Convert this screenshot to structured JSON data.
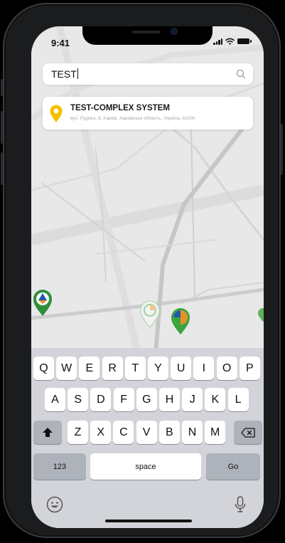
{
  "status_bar": {
    "time": "9:41"
  },
  "search": {
    "value": "TEST"
  },
  "result": {
    "title": "TEST-COMPLEX SYSTEM",
    "address": "вул. Рудика, 6, Харків, Харківська область, Україна, 61000"
  },
  "keyboard": {
    "row1": [
      "Q",
      "W",
      "E",
      "R",
      "T",
      "Y",
      "U",
      "I",
      "O",
      "P"
    ],
    "row2": [
      "A",
      "S",
      "D",
      "F",
      "G",
      "H",
      "J",
      "K",
      "L"
    ],
    "row3": [
      "Z",
      "X",
      "C",
      "V",
      "B",
      "N",
      "M"
    ],
    "numbers_label": "123",
    "space_label": "space",
    "go_label": "Go",
    "shift_icon": "shift-icon",
    "backspace_icon": "backspace-icon",
    "emoji_icon": "emoji-icon",
    "mic_icon": "microphone-icon"
  },
  "colors": {
    "pin_yellow": "#f2c200",
    "marker_green": "#3da33d",
    "marker_blue": "#1e5aa8",
    "marker_orange": "#e8902a",
    "map_background": "#e9e9e9",
    "keyboard_background": "#d2d4da"
  }
}
